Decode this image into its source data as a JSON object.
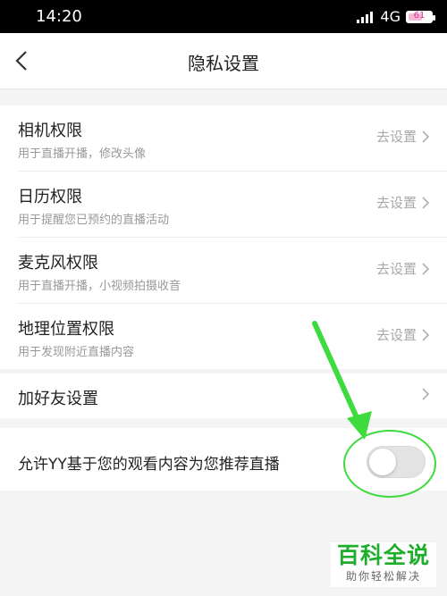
{
  "status_bar": {
    "time": "14:20",
    "network": "4G",
    "battery": "61"
  },
  "header": {
    "title": "隐私设置"
  },
  "permissions": [
    {
      "title": "相机权限",
      "subtitle": "用于直播开播，修改头像",
      "action": "去设置"
    },
    {
      "title": "日历权限",
      "subtitle": "用于提醒您已预约的直播活动",
      "action": "去设置"
    },
    {
      "title": "麦克风权限",
      "subtitle": "用于直播开播，小视频拍摄收音",
      "action": "去设置"
    },
    {
      "title": "地理位置权限",
      "subtitle": "用于发现附近直播内容",
      "action": "去设置"
    }
  ],
  "friend_settings": {
    "title": "加好友设置"
  },
  "recommendation": {
    "title": "允许YY基于您的观看内容为您推荐直播",
    "enabled": false
  },
  "watermark": {
    "main": "百科全说",
    "sub": "助你轻松解决"
  },
  "colors": {
    "annotation": "#3ddb3d",
    "watermark": "#1fae2b",
    "battery": "#e0338f"
  }
}
